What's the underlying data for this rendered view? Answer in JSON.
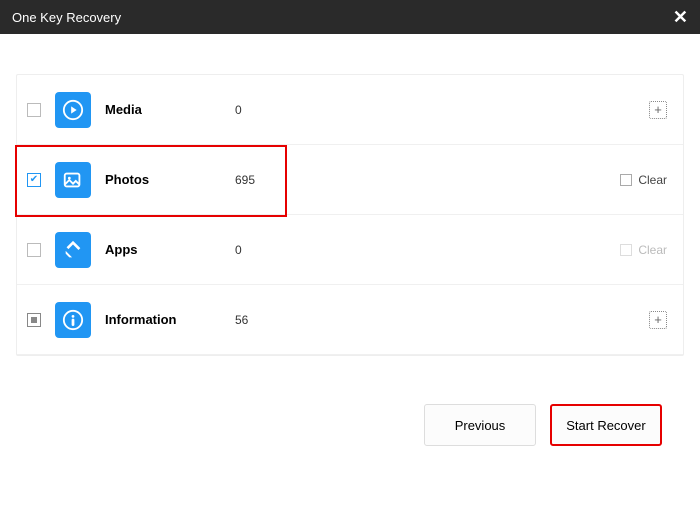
{
  "window": {
    "title": "One Key Recovery"
  },
  "categories": [
    {
      "label": "Media",
      "count": "0",
      "checkbox": "empty",
      "icon": "play-icon",
      "action": "expand"
    },
    {
      "label": "Photos",
      "count": "695",
      "checkbox": "checked",
      "icon": "photo-icon",
      "action": "clear"
    },
    {
      "label": "Apps",
      "count": "0",
      "checkbox": "empty",
      "icon": "apps-icon",
      "action": "clear-dim"
    },
    {
      "label": "Information",
      "count": "56",
      "checkbox": "indeterminate",
      "icon": "info-icon",
      "action": "expand"
    }
  ],
  "actions": {
    "clear": "Clear",
    "expand": "+"
  },
  "footer": {
    "previous": "Previous",
    "start": "Start Recover"
  }
}
